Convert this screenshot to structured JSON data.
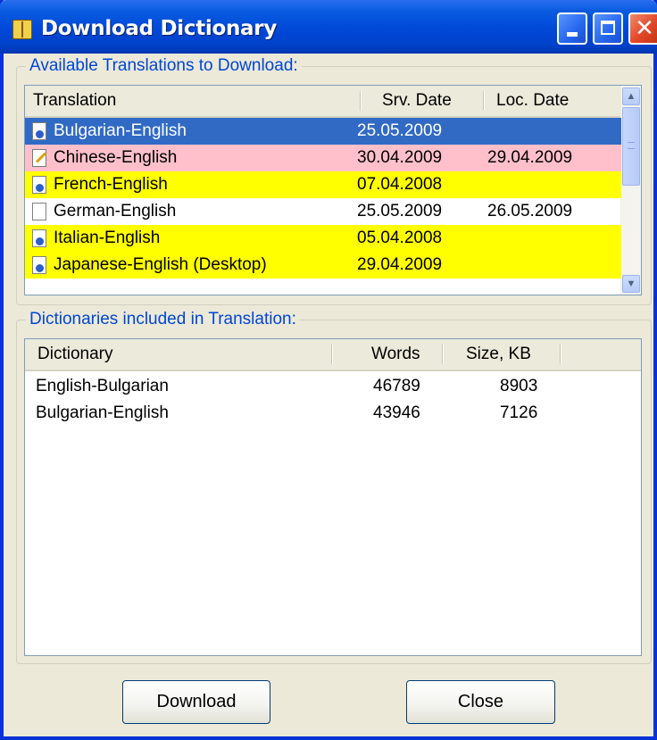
{
  "window": {
    "title": "Download Dictionary",
    "title_icon": "dictionary-book-icon",
    "controls": {
      "minimize": "minimize-icon",
      "maximize": "maximize-icon",
      "close_glyph": "✕"
    }
  },
  "translations_group": {
    "legend": "Available Translations to Download:",
    "columns": [
      "Translation",
      "Srv. Date",
      "Loc. Date"
    ],
    "rows": [
      {
        "name": "Bulgarian-English",
        "srv_date": "25.05.2009",
        "loc_date": "",
        "state": "selected",
        "icon": "download-doc-icon"
      },
      {
        "name": "Chinese-English",
        "srv_date": "30.04.2009",
        "loc_date": "29.04.2009",
        "state": "update",
        "icon": "edit-doc-icon"
      },
      {
        "name": "French-English",
        "srv_date": "07.04.2008",
        "loc_date": "",
        "state": "new",
        "icon": "download-doc-icon"
      },
      {
        "name": "German-English",
        "srv_date": "25.05.2009",
        "loc_date": "26.05.2009",
        "state": "installed",
        "icon": "doc-icon"
      },
      {
        "name": "Italian-English",
        "srv_date": "05.04.2008",
        "loc_date": "",
        "state": "new",
        "icon": "download-doc-icon"
      },
      {
        "name": "Japanese-English (Desktop)",
        "srv_date": "29.04.2009",
        "loc_date": "",
        "state": "new",
        "icon": "download-doc-icon"
      }
    ]
  },
  "dictionaries_group": {
    "legend": "Dictionaries included in Translation:",
    "columns": [
      "Dictionary",
      "Words",
      "Size, KB"
    ],
    "rows": [
      {
        "name": "English-Bulgarian",
        "words": "46789",
        "size": "8903"
      },
      {
        "name": "Bulgarian-English",
        "words": "43946",
        "size": "7126"
      }
    ]
  },
  "buttons": {
    "download": "Download",
    "close": "Close"
  },
  "colors": {
    "selected": "#316ac5",
    "update": "#ffc0cb",
    "new": "#ffff00",
    "legend": "#0046d5"
  }
}
